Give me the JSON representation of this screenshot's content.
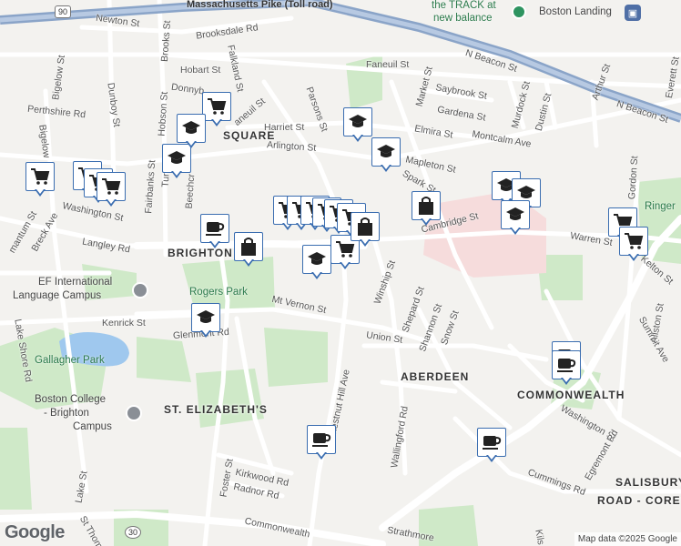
{
  "map": {
    "labels": {
      "highway": "Massachusetts Pike (Toll road)",
      "shield_90": "90",
      "shield_30": "30",
      "areas": [
        "BRIGHTON",
        "ABERDEEN",
        "ST. ELIZABETH'S",
        "COMMONWEALTH"
      ],
      "area_partial": [
        "SQUARE",
        "SALISBURY",
        "ROAD - COREY FARM"
      ],
      "pois": [
        "the TRACK at",
        "new balance",
        "Boston Landing",
        "EF International",
        "Language Campus",
        "Boston College",
        "- Brighton",
        "Campus",
        "Rogers Park",
        "Gallagher Park",
        "Ringer"
      ],
      "streets": {
        "newton": "Newton St",
        "brooks": "Brooks St",
        "brooksdale": "Brooksdale Rd",
        "hobart": "Hobart St",
        "donnybrook": "Donnyb",
        "faneuil_w": "aneuil St",
        "faneuil": "Faneuil St",
        "falkland": "Falkland St",
        "parsons": "Parsons St",
        "market": "Market St",
        "n_beacon": "N Beacon St",
        "n_beacon2": "N Beacon St",
        "saybrook": "Saybrook St",
        "gardena": "Gardena St",
        "elmira": "Elmira St",
        "montcalm": "Montcalm Ave",
        "murdock": "Murdock St",
        "dustin": "Dustin St",
        "arthur": "Arthur St",
        "everett": "Everett St",
        "harriet": "Harriet St",
        "arlington": "Arlington St",
        "mapleton": "Mapleton St",
        "bigelow": "Bigelow St",
        "bigelow2": "Bigelow",
        "perthshire": "Perthshire Rd",
        "dunboy": "Dunboy St",
        "hobson": "Hobson St",
        "fairbanks": "Fairbanks St",
        "beechcroft": "Beechcr",
        "turner": "Turn",
        "washington": "Washington St",
        "washington2": "Washington St",
        "langley": "Langley Rd",
        "breck": "Breck Ave",
        "mantum": "mantum St",
        "cambridge": "Cambridge St",
        "warren": "Warren St",
        "kelton": "Kelton St",
        "gordon": "Gordon St",
        "spark": "Spark St",
        "winship": "Winship St",
        "shepard": "Shepard St",
        "shannon": "Shannon St",
        "snow": "Snow St",
        "mt_vernon": "Mt Vernon St",
        "union": "Union St",
        "kenrick": "Kenrick St",
        "glenmont": "Glenmont Rd",
        "lake_shore": "Lake Shore Rd",
        "chestnut_hill": "Chestnut Hill Ave",
        "wallingford": "Wallingford Rd",
        "summit": "Summit Ave",
        "allston": "Allston St",
        "egremont": "Egremont Rd",
        "cummings": "Cummings Rd",
        "foster": "Foster St",
        "kirkwood": "Kirkwood Rd",
        "radnor": "Radnor Rd",
        "commonwealth": "Commonwealth",
        "lake": "Lake St",
        "st_thomas": "St Thom",
        "strathmore": "Strathmore",
        "kilsyth": "Kils"
      }
    },
    "google_logo": "Google",
    "attribution": "Map data ©2025 Google"
  },
  "markers": [
    {
      "type": "shopping-cart",
      "name": "grocery-marker"
    },
    {
      "type": "graduation-cap",
      "name": "school-marker"
    },
    {
      "type": "coffee-cup",
      "name": "cafe-marker"
    },
    {
      "type": "shopping-bag",
      "name": "shop-marker"
    }
  ],
  "colors": {
    "marker_border": "#3a6db0",
    "marker_icon": "#222222",
    "park": "#cfe9c8",
    "water": "#9fc8ee",
    "highway": "#8aa4c8",
    "road": "#ffffff",
    "hospital": "#f6dcdc"
  }
}
